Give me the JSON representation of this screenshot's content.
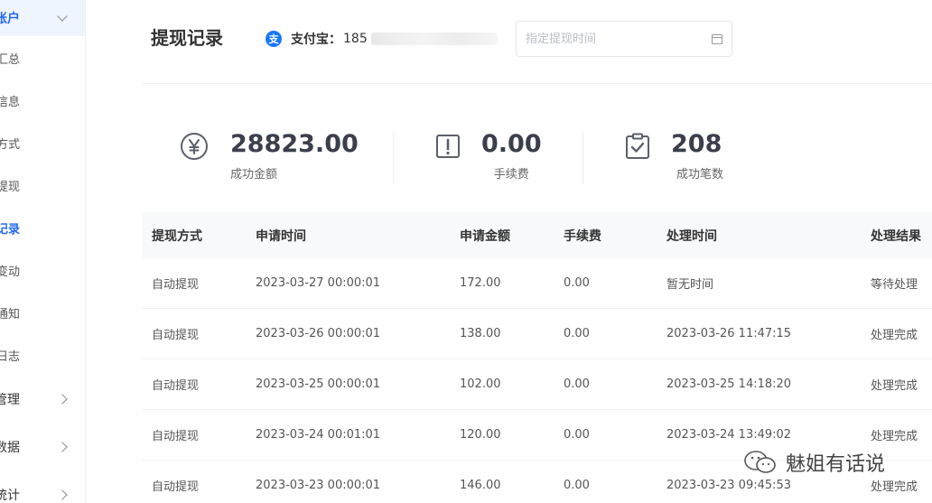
{
  "sidebar": {
    "top_group": "账户",
    "items": [
      "汇总",
      "信息",
      "方式",
      "提现",
      "记录",
      "变动",
      "通知",
      "日志"
    ],
    "active_index": 4,
    "groups": [
      "管理",
      "数据",
      "统计"
    ]
  },
  "header": {
    "title": "提现记录",
    "alipay_label": "支付宝：",
    "alipay_account": "185",
    "date_placeholder": "指定提现时间"
  },
  "stats": [
    {
      "value": "28823.00",
      "label": "成功金额",
      "icon": "yen-icon"
    },
    {
      "value": "0.00",
      "label": "手续费",
      "icon": "exclamation-icon"
    },
    {
      "value": "208",
      "label": "成功笔数",
      "icon": "clipboard-check-icon"
    }
  ],
  "table": {
    "columns": [
      "提现方式",
      "申请时间",
      "申请金额",
      "手续费",
      "处理时间",
      "处理结果"
    ],
    "rows": [
      [
        "自动提现",
        "2023-03-27 00:00:01",
        "172.00",
        "0.00",
        "暂无时间",
        "等待处理"
      ],
      [
        "自动提现",
        "2023-03-26 00:00:01",
        "138.00",
        "0.00",
        "2023-03-26 11:47:15",
        "处理完成"
      ],
      [
        "自动提现",
        "2023-03-25 00:00:01",
        "102.00",
        "0.00",
        "2023-03-25 14:18:20",
        "处理完成"
      ],
      [
        "自动提现",
        "2023-03-24 00:01:01",
        "120.00",
        "0.00",
        "2023-03-24 13:49:02",
        "处理完成"
      ],
      [
        "自动提现",
        "2023-03-23 00:00:01",
        "146.00",
        "0.00",
        "2023-03-23 09:45:53",
        "处理完成"
      ]
    ]
  },
  "watermark": {
    "text": "魅姐有话说"
  },
  "colors": {
    "accent": "#2468f2",
    "alipay": "#1677ff",
    "stat_icon": "#5a5f6b"
  }
}
